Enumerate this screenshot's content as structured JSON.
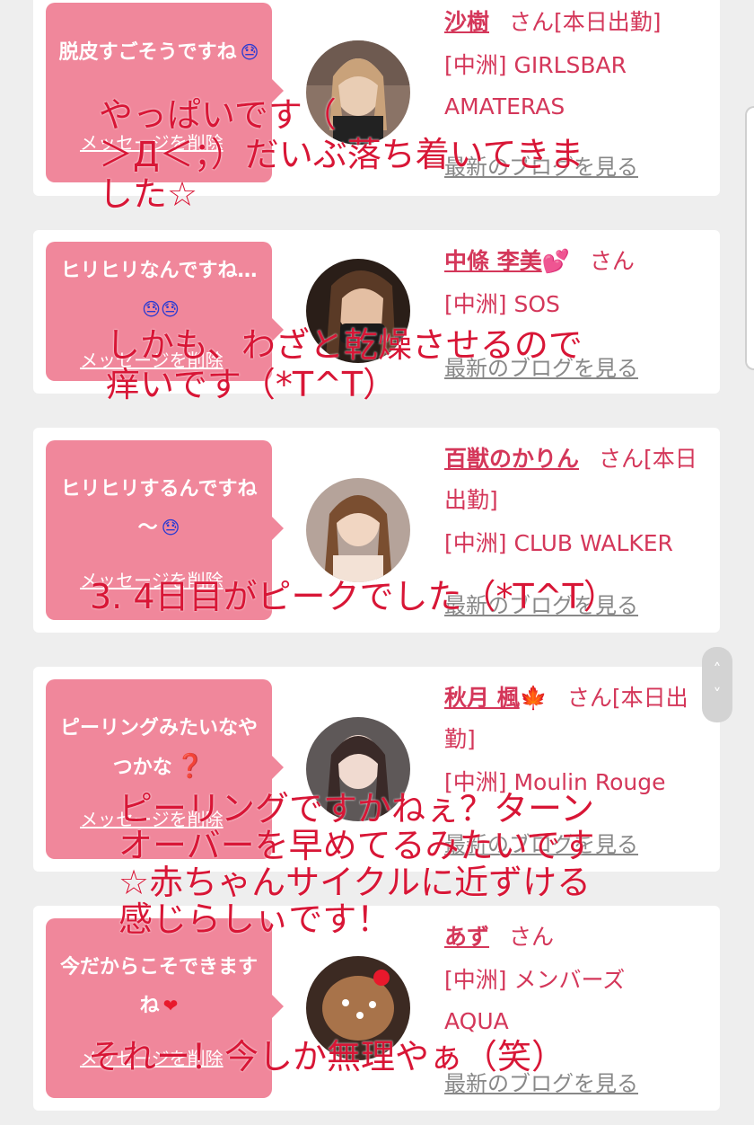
{
  "cards": [
    {
      "message": "脱皮すごそうですね",
      "emoji": "😓",
      "delete_label": "メッセージを削除",
      "girl_name": "沙樹",
      "girl_emoji": "",
      "honorific": "さん[本日出勤]",
      "shop": "[中洲] GIRLSBAR AMATERAS",
      "blog_link": "最新のブログを見る"
    },
    {
      "message": "ヒリヒリなんですね…",
      "emoji": "😓😓",
      "delete_label": "メッセージを削除",
      "girl_name": "中條 李美",
      "girl_emoji": "💕",
      "honorific": "さん",
      "shop": "[中洲] SOS",
      "blog_link": "最新のブログを見る"
    },
    {
      "message": "ヒリヒリするんですね～",
      "emoji": "😓",
      "delete_label": "メッセージを削除",
      "girl_name": "百獣のかりん",
      "girl_emoji": "",
      "honorific": "さん[本日出勤]",
      "shop": "[中洲] CLUB WALKER",
      "blog_link": "最新のブログを見る"
    },
    {
      "message": "ピーリングみたいなやつかな",
      "emoji": "❓",
      "delete_label": "メッセージを削除",
      "girl_name": "秋月 楓",
      "girl_emoji": "🍁",
      "honorific": "さん[本日出勤]",
      "shop": "[中洲] Moulin Rouge",
      "blog_link": "最新のブログを見る"
    },
    {
      "message": "今だからこそできますね",
      "emoji": "❤",
      "delete_label": "メッセージを削除",
      "girl_name": "あず",
      "girl_emoji": "",
      "honorific": "さん",
      "shop": "[中洲] メンバーズ AQUA",
      "blog_link": "最新のブログを見る"
    }
  ],
  "overlays": [
    "やっぱいです（\n＞Д＜；）だいぶ落ち着いてきま\nした☆",
    "しかも、わざと乾燥させるので\n痒いです（*T^T）",
    "3. 4日目がピークでした（*T^T）",
    "ピーリングですかねぇ？ターン\nオーバーを早めてるみたいです\n☆赤ちゃんサイクルに近ずける\n感じらしぃです！",
    "それー！今しか無理やぁ（笑）"
  ],
  "scroll": {
    "up_icon": "˄",
    "down_icon": "˅"
  },
  "colors": {
    "bubble": "#f0879b",
    "name": "#d4375a",
    "overlay_text": "#d81636",
    "sweat_emoji": "#2a3bd2",
    "heart": "#e8192c"
  }
}
